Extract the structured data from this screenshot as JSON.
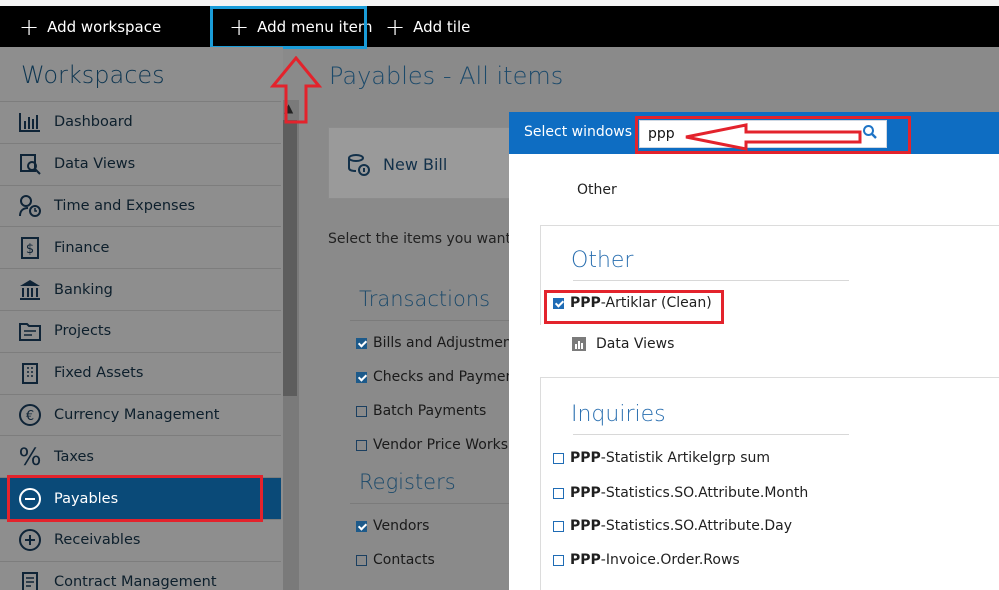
{
  "toolbar": {
    "add_workspace": "Add workspace",
    "add_menu_item": "Add menu item",
    "add_tile": "Add tile"
  },
  "sidebar": {
    "title": "Workspaces",
    "items": [
      {
        "label": "Dashboard",
        "icon": "dashboard-icon"
      },
      {
        "label": "Data Views",
        "icon": "data-views-icon"
      },
      {
        "label": "Time and Expenses",
        "icon": "time-expenses-icon"
      },
      {
        "label": "Finance",
        "icon": "finance-icon"
      },
      {
        "label": "Banking",
        "icon": "bank-icon"
      },
      {
        "label": "Projects",
        "icon": "projects-icon"
      },
      {
        "label": "Fixed Assets",
        "icon": "building-icon"
      },
      {
        "label": "Currency Management",
        "icon": "euro-icon"
      },
      {
        "label": "Taxes",
        "icon": "percent-icon"
      },
      {
        "label": "Payables",
        "icon": "minus-circle-icon"
      },
      {
        "label": "Receivables",
        "icon": "plus-circle-icon"
      },
      {
        "label": "Contract Management",
        "icon": "contract-icon"
      }
    ],
    "active_index": 9
  },
  "main": {
    "title": "Payables - All items",
    "new_bill": "New Bill",
    "select_text": "Select the items you want to",
    "transactions": {
      "title": "Transactions",
      "items": [
        {
          "label": "Bills and Adjustments",
          "checked": true
        },
        {
          "label": "Checks and Payments",
          "checked": true
        },
        {
          "label": "Batch Payments",
          "checked": false
        },
        {
          "label": "Vendor Price Worksh",
          "checked": false
        }
      ]
    },
    "registers": {
      "title": "Registers",
      "items": [
        {
          "label": "Vendors",
          "checked": true
        },
        {
          "label": "Contacts",
          "checked": false
        }
      ]
    }
  },
  "popup": {
    "title": "Select windows",
    "search_value": "ppp",
    "other_label": "Other",
    "groups": {
      "other": {
        "title": "Other",
        "item": {
          "bold": "PPP",
          "rest": "-Artiklar (Clean)",
          "checked": true
        },
        "data_views": "Data Views"
      },
      "inquiries": {
        "title": "Inquiries",
        "items": [
          {
            "bold": "PPP",
            "rest": "-Statistik Artikelgrp sum",
            "checked": false
          },
          {
            "bold": "PPP",
            "rest": "-Statistics.SO.Attribute.Month",
            "checked": false
          },
          {
            "bold": "PPP",
            "rest": "-Statistics.SO.Attribute.Day",
            "checked": false
          },
          {
            "bold": "PPP",
            "rest": "-Invoice.Order.Rows",
            "checked": false
          }
        ]
      }
    }
  },
  "colors": {
    "topbar": "#000000",
    "accent_blue": "#0e6dc2",
    "highlight_cyan": "#1a9cd8",
    "annotation_red": "#e3232c",
    "active_nav": "#0a4a78"
  }
}
